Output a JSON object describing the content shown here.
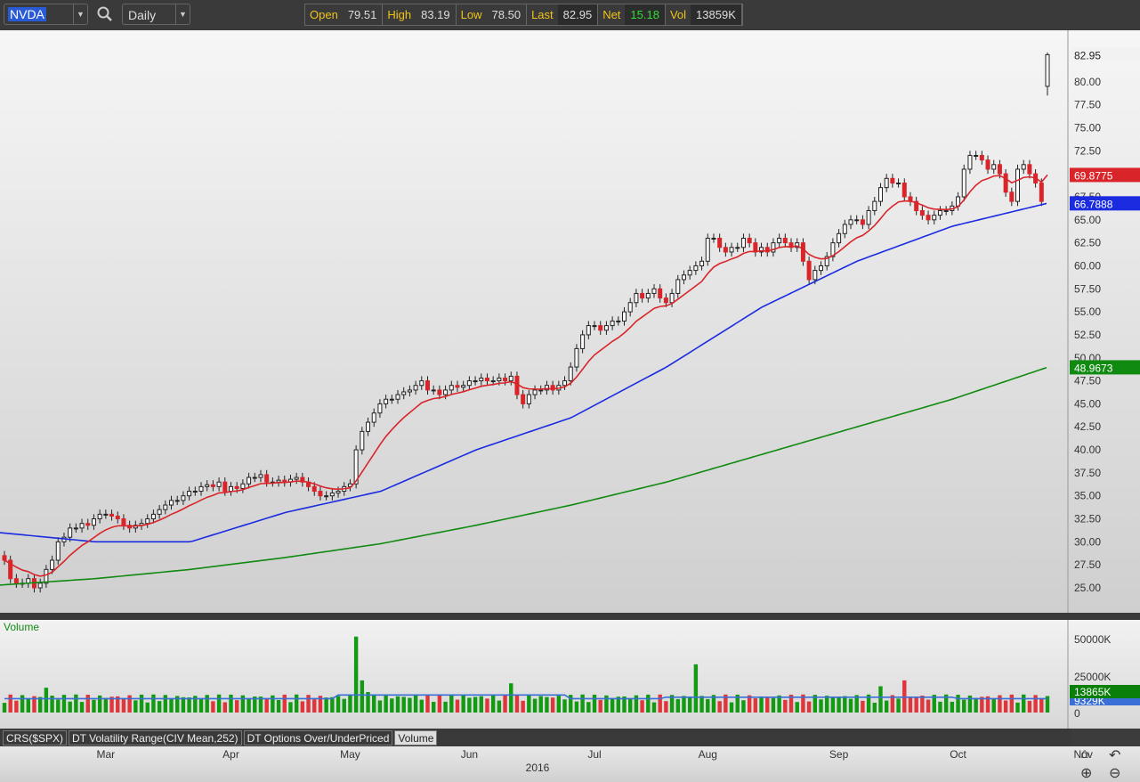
{
  "toolbar": {
    "symbol": "NVDA",
    "period": "Daily",
    "quote": [
      {
        "label": "Open",
        "value": "79.51"
      },
      {
        "label": "High",
        "value": "83.19"
      },
      {
        "label": "Low",
        "value": "78.50"
      },
      {
        "label": "Last",
        "value": "82.95"
      },
      {
        "label": "Net",
        "value": "15.18"
      },
      {
        "label": "Vol",
        "value": "13859K"
      }
    ]
  },
  "colors": {
    "up": "#ffffff",
    "down": "#d9252a",
    "ma_fast": "#d9252a",
    "ma_mid": "#1a2be0",
    "ma_slow": "#118a11",
    "vol_up": "#129a12",
    "vol_down": "#e0353a",
    "vol_avg": "#3a6fd8",
    "net": "#33dd33"
  },
  "chart_data": {
    "type": "candlestick",
    "y_ticks": [
      "25.00",
      "27.50",
      "30.00",
      "32.50",
      "35.00",
      "37.50",
      "40.00",
      "42.50",
      "45.00",
      "47.50",
      "50.00",
      "52.50",
      "55.00",
      "57.50",
      "60.00",
      "62.50",
      "65.00",
      "67.50",
      "70.00",
      "72.50",
      "75.00",
      "77.50",
      "80.00"
    ],
    "ylim": [
      22.5,
      85
    ],
    "closes": [
      28,
      26,
      25.5,
      25.5,
      26,
      25,
      25.5,
      27,
      28,
      30,
      30.5,
      31.5,
      31.5,
      32,
      31.8,
      32.5,
      33,
      33,
      32.8,
      32.5,
      31.8,
      31.5,
      31.8,
      32,
      32.5,
      33,
      33.5,
      34,
      34.5,
      34.5,
      35,
      35.5,
      35.5,
      36,
      36.2,
      36,
      36.5,
      35.5,
      36,
      35.8,
      36.3,
      37,
      37,
      37.3,
      36.5,
      36.5,
      36.7,
      36.5,
      36.8,
      37,
      36.5,
      36,
      35.5,
      35,
      35,
      35.3,
      35.5,
      36,
      36.3,
      40,
      42,
      43,
      44,
      45,
      45.5,
      45.5,
      46,
      46.3,
      46.5,
      47,
      47.5,
      46.5,
      46.5,
      46,
      46.5,
      47,
      46.8,
      47,
      47.5,
      47.5,
      47.8,
      47.5,
      47.5,
      47.8,
      47.5,
      48,
      46,
      45,
      46,
      46.5,
      46.5,
      47,
      46.5,
      47,
      47.5,
      49,
      51,
      52.5,
      53.5,
      53.5,
      53,
      53.5,
      54,
      54,
      55,
      56,
      57,
      56.5,
      57,
      57.5,
      56.5,
      56,
      57,
      58.5,
      59,
      59.5,
      60,
      60.5,
      63,
      63,
      62,
      61.5,
      62,
      62,
      63,
      62.5,
      61.5,
      62,
      61.5,
      62.5,
      63,
      62.5,
      62,
      62.5,
      60.5,
      58.5,
      59.5,
      60,
      61,
      62.5,
      63.5,
      64.5,
      65,
      65,
      64.5,
      66,
      67,
      68.5,
      69.5,
      69,
      69,
      67.5,
      67,
      66,
      65.5,
      65,
      65.5,
      66,
      66,
      66.5,
      67.5,
      70.5,
      72,
      72,
      71.5,
      70.5,
      71,
      70,
      68,
      67,
      70.5,
      71,
      70,
      69,
      67,
      82.95
    ],
    "last_open": 79.51,
    "ma_mid_points": [
      31,
      30,
      30,
      33.2,
      35.5,
      40,
      43.5,
      49,
      55.5,
      60.5,
      64.3,
      66.8
    ],
    "ma_slow_points": [
      25.3,
      26,
      27,
      28.3,
      29.8,
      31.8,
      34,
      36.5,
      39.5,
      42.5,
      45.5,
      48.97
    ],
    "labels": {
      "last": "82.95",
      "ma_fast": "69.8775",
      "ma_mid": "66.7888",
      "ma_slow": "48.9673"
    },
    "x_ticks": [
      {
        "label": "Mar",
        "day": 17
      },
      {
        "label": "Apr",
        "day": 38
      },
      {
        "label": "May",
        "day": 58
      },
      {
        "label": "Jun",
        "day": 78
      },
      {
        "label": "Jul",
        "day": 99
      },
      {
        "label": "Aug",
        "day": 118
      },
      {
        "label": "Sep",
        "day": 140
      },
      {
        "label": "Oct",
        "day": 160
      },
      {
        "label": "Nov",
        "day": 181
      }
    ],
    "year_label": "2016",
    "volume": {
      "title": "Volume",
      "y_ticks": [
        "50000K",
        "25000K",
        "0"
      ],
      "ymax": 60000,
      "base": 9500,
      "spikes": {
        "7": 17000,
        "59": 52000,
        "60": 22000,
        "61": 14000,
        "85": 20000,
        "116": 33000,
        "147": 18000,
        "151": 22000,
        "186": 22000,
        "187": 13865
      },
      "label_current": "13865K",
      "label_avg": "9329K"
    }
  },
  "tabs": [
    "CRS($SPX)",
    "DT Volatility Range(CIV Mean,252)",
    "DT Options Over/UnderPriced",
    "Volume"
  ]
}
